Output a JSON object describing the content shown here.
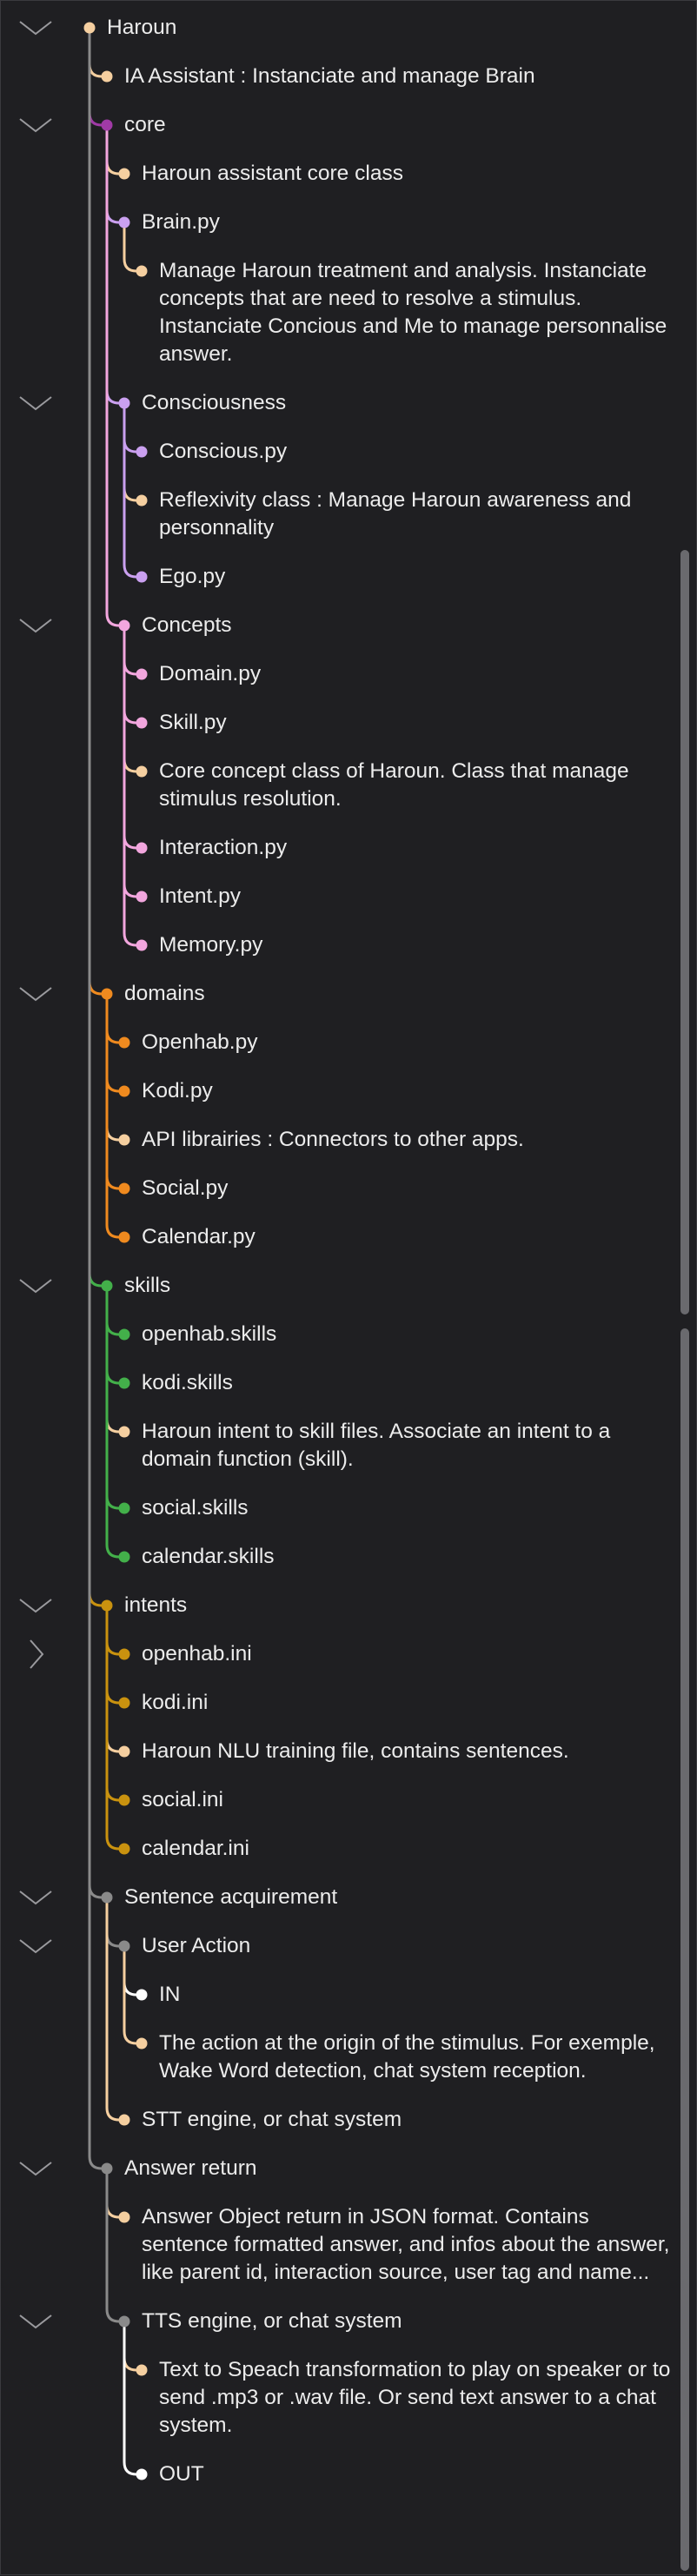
{
  "colors": {
    "background": "#1f1f22",
    "text": "#ececec",
    "peach": "#f5cfa0",
    "magenta": "#a03aa6",
    "lilac": "#caa0f0",
    "pink": "#f2a6de",
    "orange": "#ef8a1f",
    "green": "#43b04a",
    "mustard": "#c9920f",
    "gray": "#8a8a8a",
    "white": "#ffffff"
  },
  "nodes": [
    {
      "label": "Haroun",
      "parent": null,
      "color": "peach",
      "toggle": "expanded"
    },
    {
      "label": "IA Assistant : Instanciate and manage Brain",
      "parent": 0,
      "color": "peach"
    },
    {
      "label": "core",
      "parent": 0,
      "color": "magenta",
      "toggle": "expanded"
    },
    {
      "label": "Haroun assistant core class",
      "parent": 2,
      "color": "peach"
    },
    {
      "label": "Brain.py",
      "parent": 2,
      "color": "lilac"
    },
    {
      "label": "Manage Haroun treatment and analysis. Instanciate concepts that are need to resolve a stimulus. Instanciate Concious and Me to manage personnalise answer.",
      "parent": 4,
      "color": "peach"
    },
    {
      "label": "Consciousness",
      "parent": 2,
      "color": "lilac",
      "toggle": "expanded"
    },
    {
      "label": "Conscious.py",
      "parent": 6,
      "color": "lilac"
    },
    {
      "label": "Reflexivity class : Manage Haroun awareness and personnality",
      "parent": 6,
      "color": "peach"
    },
    {
      "label": "Ego.py",
      "parent": 6,
      "color": "lilac"
    },
    {
      "label": "Concepts",
      "parent": 2,
      "color": "pink",
      "toggle": "expanded"
    },
    {
      "label": "Domain.py",
      "parent": 10,
      "color": "pink"
    },
    {
      "label": "Skill.py",
      "parent": 10,
      "color": "pink"
    },
    {
      "label": "Core concept class of Haroun. Class that manage stimulus resolution.",
      "parent": 10,
      "color": "peach"
    },
    {
      "label": "Interaction.py",
      "parent": 10,
      "color": "pink"
    },
    {
      "label": "Intent.py",
      "parent": 10,
      "color": "pink"
    },
    {
      "label": "Memory.py",
      "parent": 10,
      "color": "pink"
    },
    {
      "label": "domains",
      "parent": 0,
      "color": "orange",
      "toggle": "expanded"
    },
    {
      "label": "Openhab.py",
      "parent": 17,
      "color": "orange"
    },
    {
      "label": "Kodi.py",
      "parent": 17,
      "color": "orange"
    },
    {
      "label": "API librairies : Connectors to other apps.",
      "parent": 17,
      "color": "peach"
    },
    {
      "label": "Social.py",
      "parent": 17,
      "color": "orange"
    },
    {
      "label": "Calendar.py",
      "parent": 17,
      "color": "orange"
    },
    {
      "label": "skills",
      "parent": 0,
      "color": "green",
      "toggle": "expanded"
    },
    {
      "label": "openhab.skills",
      "parent": 23,
      "color": "green"
    },
    {
      "label": "kodi.skills",
      "parent": 23,
      "color": "green"
    },
    {
      "label": "Haroun intent to skill files. Associate an intent to a domain function (skill).",
      "parent": 23,
      "color": "peach"
    },
    {
      "label": "social.skills",
      "parent": 23,
      "color": "green"
    },
    {
      "label": "calendar.skills",
      "parent": 23,
      "color": "green"
    },
    {
      "label": "intents",
      "parent": 0,
      "color": "mustard",
      "toggle": "expanded"
    },
    {
      "label": "openhab.ini",
      "parent": 29,
      "color": "mustard",
      "toggle": "collapsed"
    },
    {
      "label": "kodi.ini",
      "parent": 29,
      "color": "mustard"
    },
    {
      "label": "Haroun NLU training file, contains sentences.",
      "parent": 29,
      "color": "peach"
    },
    {
      "label": "social.ini",
      "parent": 29,
      "color": "mustard"
    },
    {
      "label": "calendar.ini",
      "parent": 29,
      "color": "mustard"
    },
    {
      "label": "Sentence acquirement",
      "parent": 0,
      "color": "gray",
      "toggle": "expanded"
    },
    {
      "label": "User Action",
      "parent": 35,
      "color": "gray",
      "toggle": "expanded"
    },
    {
      "label": "IN",
      "parent": 36,
      "color": "white"
    },
    {
      "label": "The action at the origin of the stimulus. For exemple, Wake Word detection, chat system reception.",
      "parent": 36,
      "color": "peach"
    },
    {
      "label": "STT engine, or chat system",
      "parent": 35,
      "color": "peach"
    },
    {
      "label": "Answer return",
      "parent": 0,
      "color": "gray",
      "toggle": "expanded"
    },
    {
      "label": "Answer Object return in JSON format. Contains sentence formatted answer, and infos about the answer, like parent id, interaction source, user tag and name...",
      "parent": 40,
      "color": "peach"
    },
    {
      "label": "TTS engine, or chat system",
      "parent": 40,
      "color": "gray",
      "toggle": "expanded"
    },
    {
      "label": "Text to Speach transformation to play on speaker or to send .mp3 or .wav file. Or send text answer to a chat system.",
      "parent": 42,
      "color": "peach"
    },
    {
      "label": "OUT",
      "parent": 42,
      "color": "white"
    }
  ]
}
